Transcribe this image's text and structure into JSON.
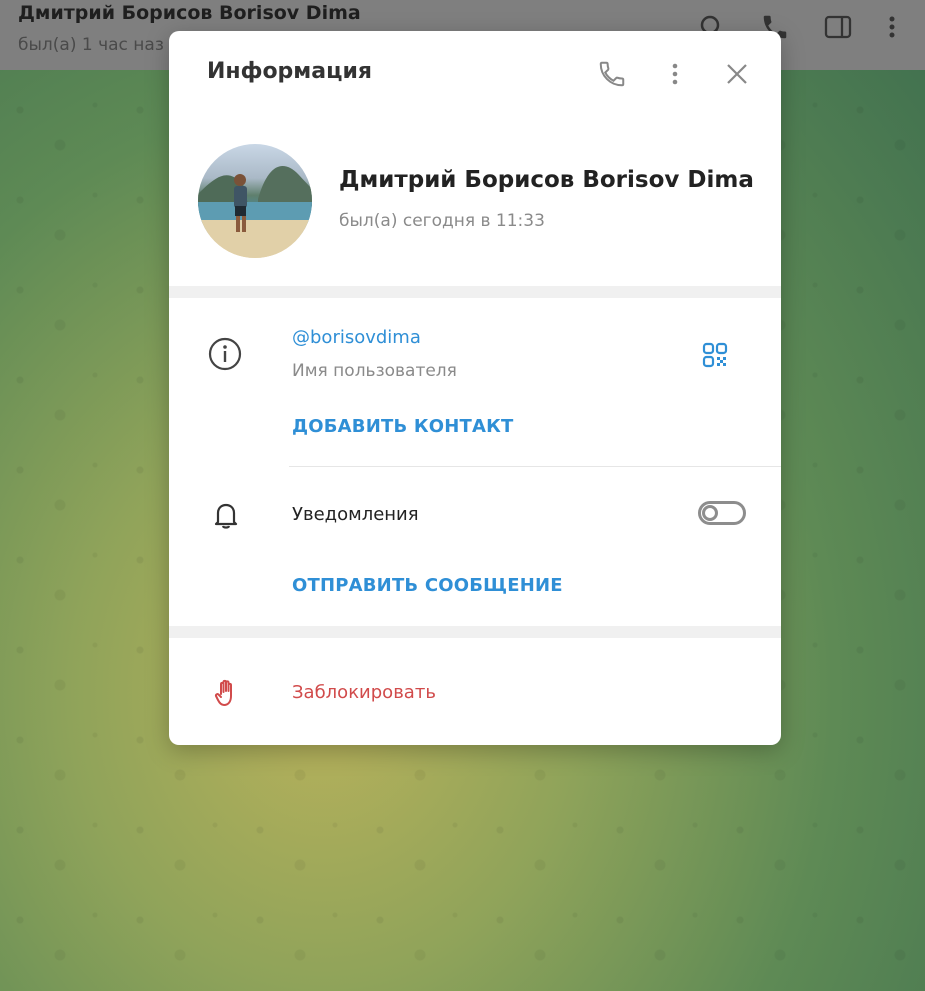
{
  "chat_header": {
    "name": "Дмитрий Борисов Borisov Dima",
    "status": "был(а) 1 час наз"
  },
  "header_icons": [
    "search-icon",
    "phone-icon",
    "sidebar-toggle-icon",
    "more-vertical-icon"
  ],
  "dialog": {
    "title": "Информация",
    "icons": [
      "phone-icon",
      "more-vertical-icon",
      "close-icon"
    ]
  },
  "profile": {
    "name": "Дмитрий Борисов Borisov Dima",
    "status": "был(а) сегодня в 11:33"
  },
  "info": {
    "username": "@borisovdima",
    "username_label": "Имя пользователя",
    "add_contact": "ДОБАВИТЬ КОНТАКТ"
  },
  "notifications": {
    "label": "Уведомления",
    "enabled": false,
    "send_message": "ОТПРАВИТЬ СООБЩЕНИЕ"
  },
  "block": {
    "label": "Заблокировать"
  },
  "colors": {
    "accent": "#2f8fd6",
    "danger": "#d14b4b"
  }
}
